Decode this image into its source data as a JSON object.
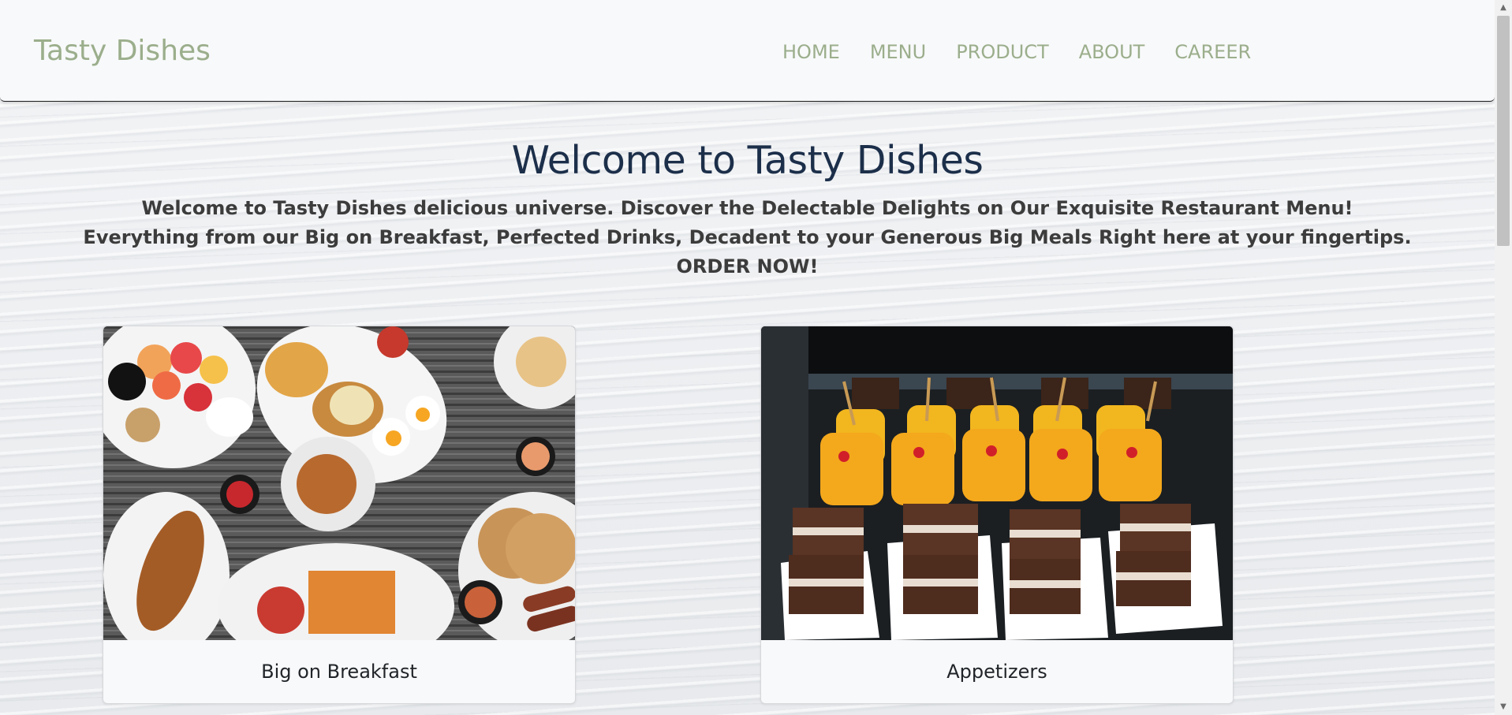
{
  "navbar": {
    "brand": "Tasty Dishes",
    "links": [
      "HOME",
      "MENU",
      "PRODUCT",
      "ABOUT",
      "CAREER"
    ]
  },
  "hero": {
    "title": "Welcome to Tasty Dishes",
    "line1": "Welcome to Tasty Dishes delicious universe. Discover the Delectable Delights on Our Exquisite Restaurant Menu!",
    "line2": "Everything from our Big on Breakfast, Perfected Drinks, Decadent to your Generous Big Meals Right here at your fingertips.",
    "line3": "ORDER NOW!"
  },
  "cards": [
    {
      "title": "Big on Breakfast",
      "image": "breakfast-platter-photo"
    },
    {
      "title": "Appetizers",
      "image": "dessert-cups-and-cake-photo"
    }
  ],
  "colors": {
    "brand": "#9bae8c",
    "heading": "#1c2f4a",
    "text": "#3c3c3c"
  }
}
